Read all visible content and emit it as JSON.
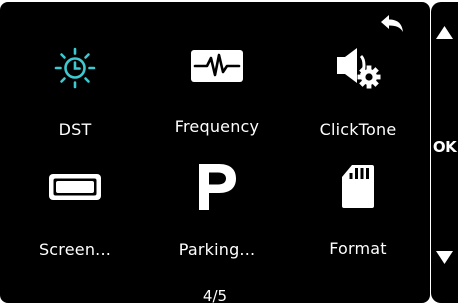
{
  "menu": {
    "items": [
      {
        "label": "DST",
        "icon": "clock-sun-icon",
        "color": "#3cc9cf"
      },
      {
        "label": "Frequency",
        "icon": "waveform-icon",
        "color": "#ffffff"
      },
      {
        "label": "ClickTone",
        "icon": "speaker-settings-icon",
        "color": "#ffffff"
      },
      {
        "label": "Screen...",
        "icon": "screen-rectangle-icon",
        "color": "#ffffff"
      },
      {
        "label": "Parking...",
        "icon": "parking-p-icon",
        "color": "#ffffff"
      },
      {
        "label": "Format",
        "icon": "sd-card-icon",
        "color": "#ffffff"
      }
    ]
  },
  "navigation": {
    "page_indicator": "4/5",
    "ok_label": "OK",
    "back_icon": "back-arrow-icon",
    "up_icon": "triangle-up-icon",
    "down_icon": "triangle-down-icon"
  },
  "colors": {
    "background": "#000000",
    "accent": "#3cc9cf",
    "text": "#ffffff"
  }
}
